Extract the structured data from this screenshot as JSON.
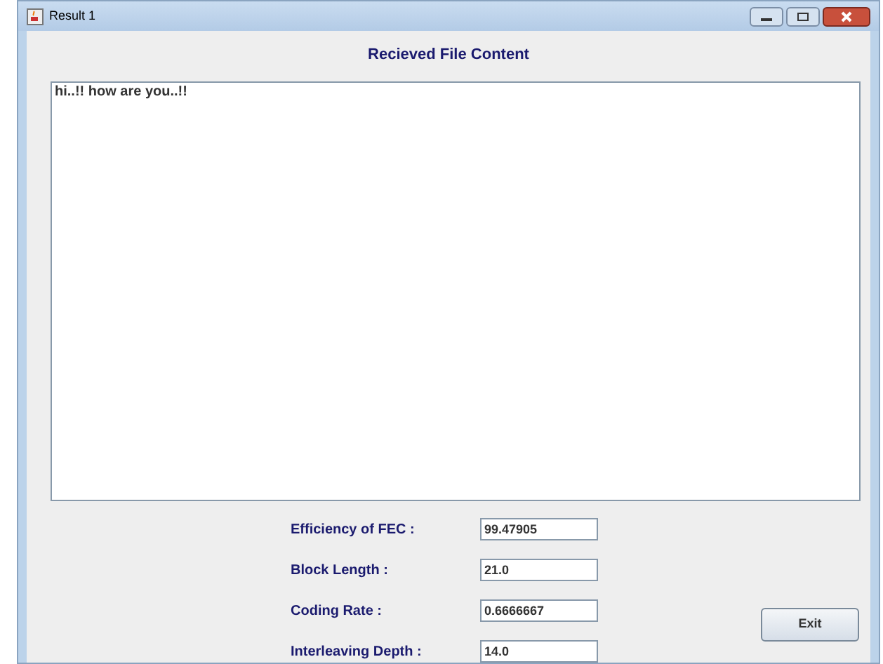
{
  "window": {
    "title": "Result 1"
  },
  "heading": "Recieved File Content",
  "content": "hi..!! how are you..!!",
  "fields": [
    {
      "label": "Efficiency of FEC :",
      "value": "99.47905"
    },
    {
      "label": "Block Length :",
      "value": "21.0"
    },
    {
      "label": "Coding Rate :",
      "value": "0.6666667"
    },
    {
      "label": "Interleaving Depth :",
      "value": "14.0"
    }
  ],
  "buttons": [
    "Exit"
  ]
}
